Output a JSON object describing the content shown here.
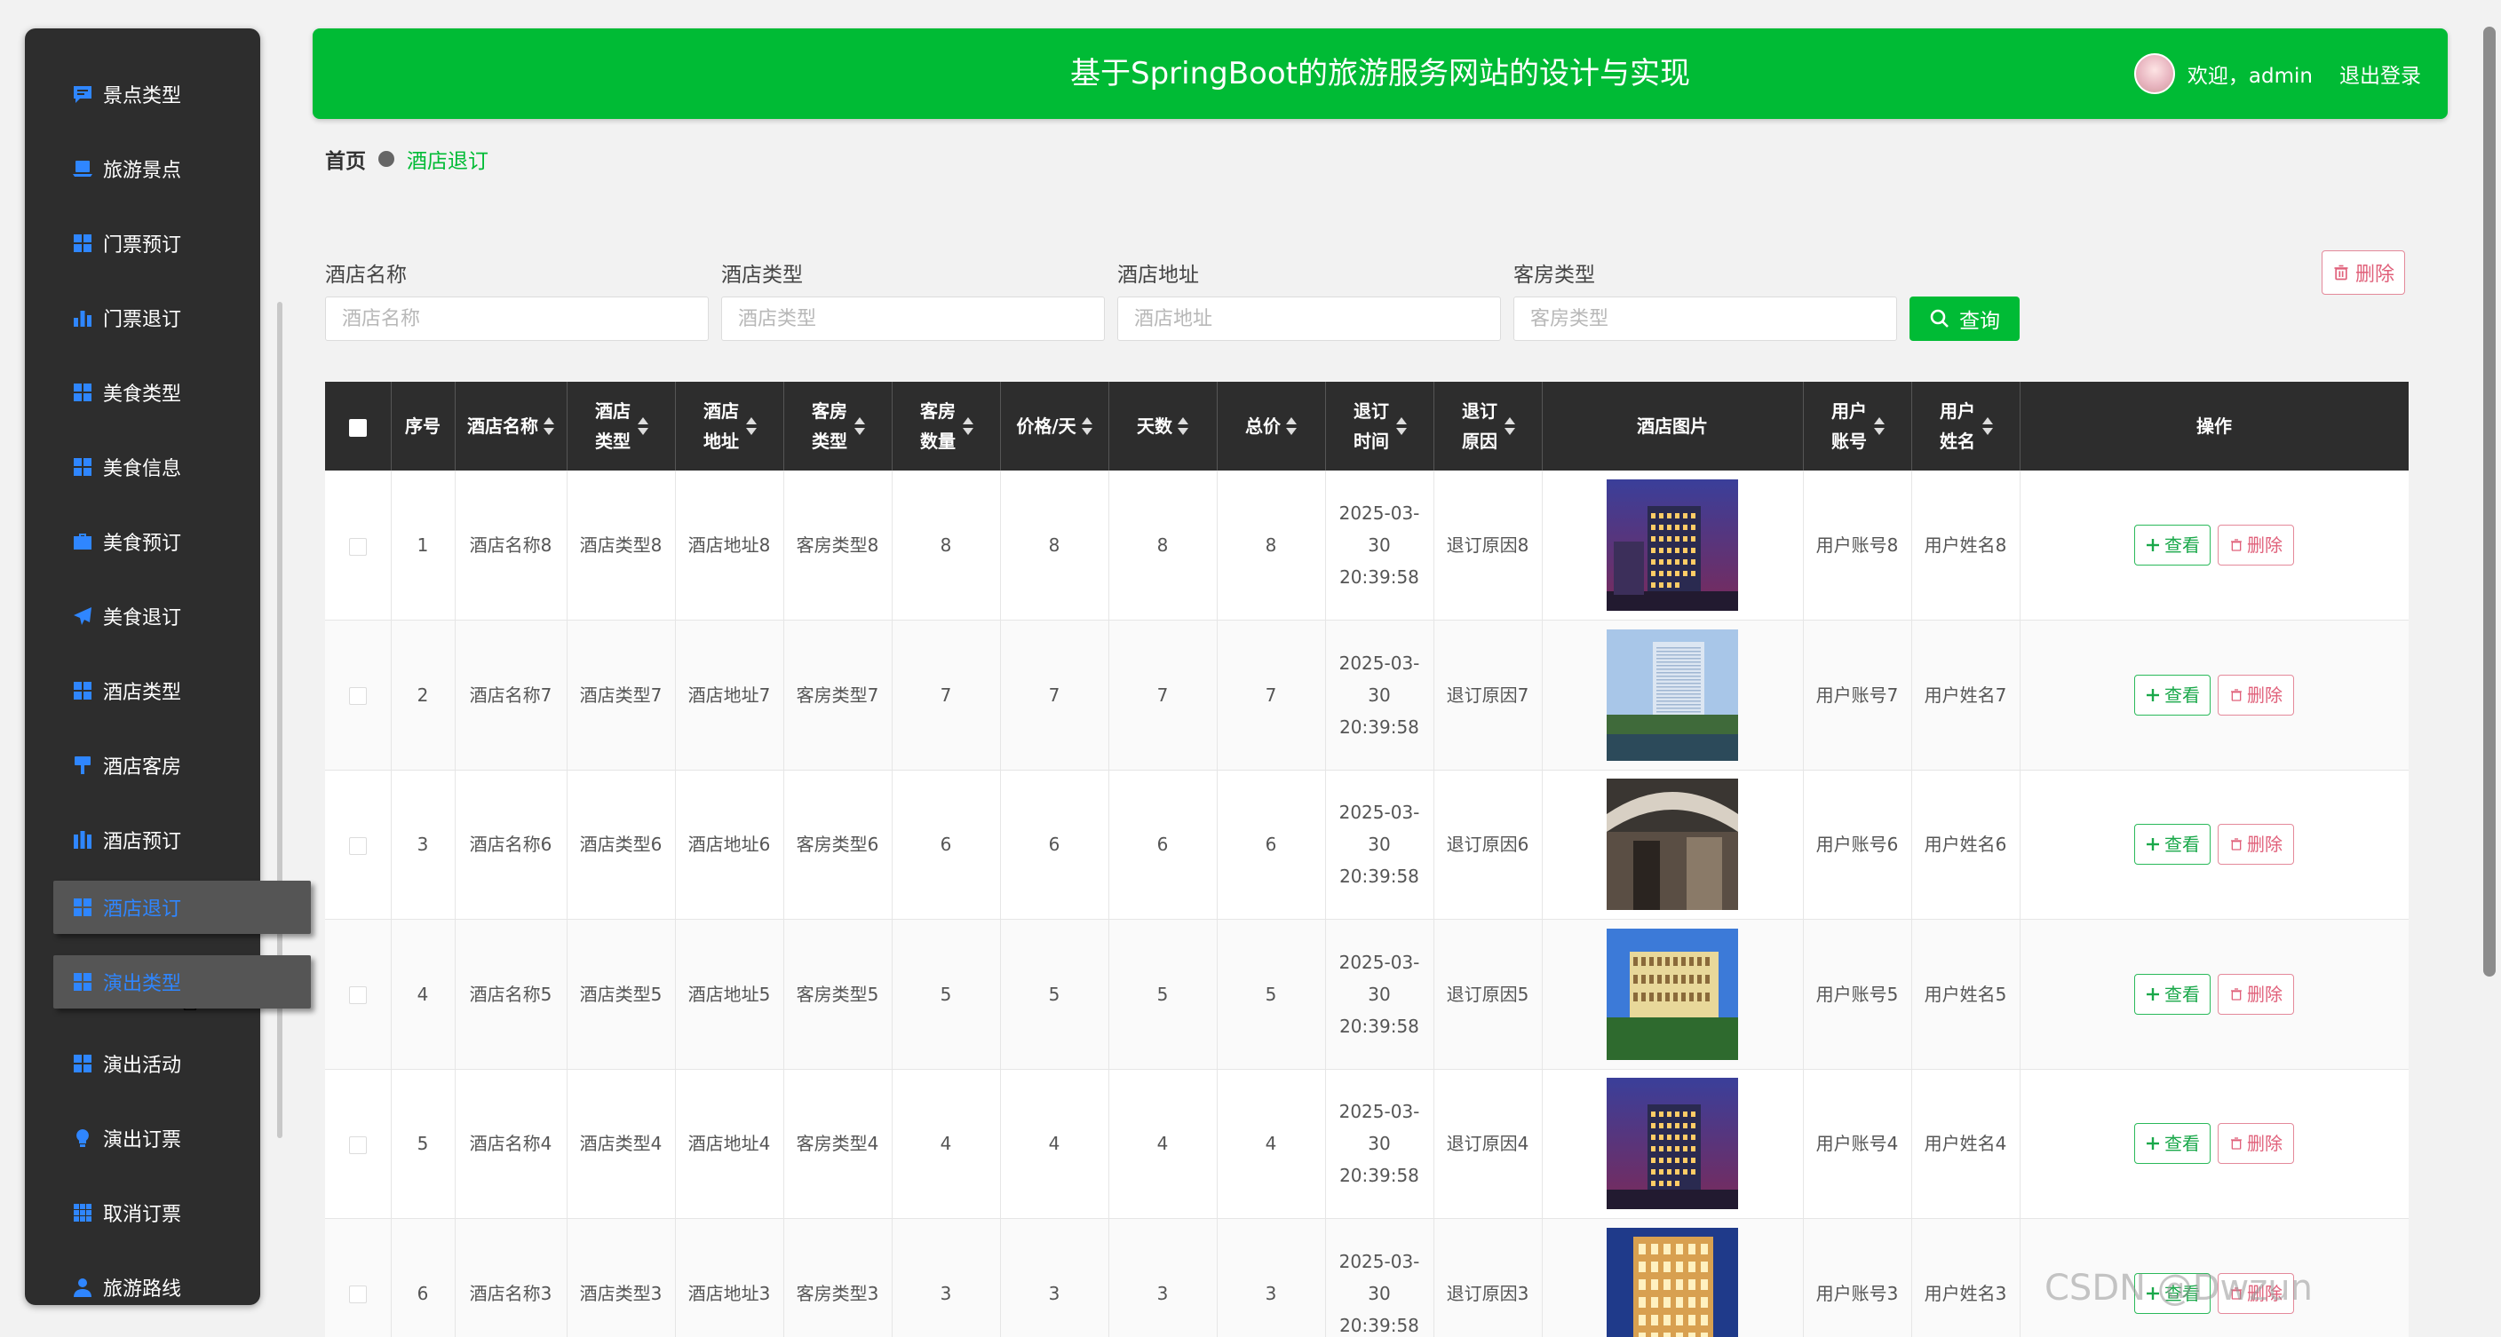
{
  "sidebar": {
    "items": [
      {
        "label": "景点类型",
        "icon": "chat-icon"
      },
      {
        "label": "旅游景点",
        "icon": "laptop-icon"
      },
      {
        "label": "门票预订",
        "icon": "grid-icon"
      },
      {
        "label": "门票退订",
        "icon": "bar-chart-icon"
      },
      {
        "label": "美食类型",
        "icon": "grid-icon"
      },
      {
        "label": "美食信息",
        "icon": "grid-icon"
      },
      {
        "label": "美食预订",
        "icon": "briefcase-icon"
      },
      {
        "label": "美食退订",
        "icon": "send-icon"
      },
      {
        "label": "酒店类型",
        "icon": "grid-icon"
      },
      {
        "label": "酒店客房",
        "icon": "brush-icon"
      },
      {
        "label": "酒店预订",
        "icon": "columns-icon"
      },
      {
        "label": "酒店退订",
        "icon": "grid-icon"
      },
      {
        "label": "演出类型",
        "icon": "grid-icon"
      },
      {
        "label": "演出活动",
        "icon": "grid-icon"
      },
      {
        "label": "演出订票",
        "icon": "bulb-icon"
      },
      {
        "label": "取消订票",
        "icon": "apps-icon"
      },
      {
        "label": "旅游路线",
        "icon": "user-icon"
      }
    ]
  },
  "header": {
    "title": "基于SpringBoot的旅游服务网站的设计与实现",
    "welcome": "欢迎，admin",
    "logout": "退出登录"
  },
  "breadcrumb": {
    "home": "首页",
    "current": "酒店退订"
  },
  "search": {
    "fields": [
      {
        "label": "酒店名称",
        "placeholder": "酒店名称"
      },
      {
        "label": "酒店类型",
        "placeholder": "酒店类型"
      },
      {
        "label": "酒店地址",
        "placeholder": "酒店地址"
      },
      {
        "label": "客房类型",
        "placeholder": "客房类型"
      }
    ],
    "query_label": "查询",
    "delete_label": "删除"
  },
  "table": {
    "columns": [
      "序号",
      "酒店名称",
      "酒店类型",
      "酒店地址",
      "客房类型",
      "客房数量",
      "价格/天",
      "天数",
      "总价",
      "退订时间",
      "退订原因",
      "酒店图片",
      "用户账号",
      "用户姓名",
      "操作"
    ],
    "view_label": "查看",
    "delete_label": "删除",
    "rows": [
      {
        "index": "1",
        "name": "酒店名称8",
        "type": "酒店类型8",
        "address": "酒店地址8",
        "room_type": "客房类型8",
        "rooms": "8",
        "price": "8",
        "days": "8",
        "total": "8",
        "time": "2025-03-30 20:39:58",
        "reason": "退订原因8",
        "account": "用户账号8",
        "username": "用户姓名8"
      },
      {
        "index": "2",
        "name": "酒店名称7",
        "type": "酒店类型7",
        "address": "酒店地址7",
        "room_type": "客房类型7",
        "rooms": "7",
        "price": "7",
        "days": "7",
        "total": "7",
        "time": "2025-03-30 20:39:58",
        "reason": "退订原因7",
        "account": "用户账号7",
        "username": "用户姓名7"
      },
      {
        "index": "3",
        "name": "酒店名称6",
        "type": "酒店类型6",
        "address": "酒店地址6",
        "room_type": "客房类型6",
        "rooms": "6",
        "price": "6",
        "days": "6",
        "total": "6",
        "time": "2025-03-30 20:39:58",
        "reason": "退订原因6",
        "account": "用户账号6",
        "username": "用户姓名6"
      },
      {
        "index": "4",
        "name": "酒店名称5",
        "type": "酒店类型5",
        "address": "酒店地址5",
        "room_type": "客房类型5",
        "rooms": "5",
        "price": "5",
        "days": "5",
        "total": "5",
        "time": "2025-03-30 20:39:58",
        "reason": "退订原因5",
        "account": "用户账号5",
        "username": "用户姓名5"
      },
      {
        "index": "5",
        "name": "酒店名称4",
        "type": "酒店类型4",
        "address": "酒店地址4",
        "room_type": "客房类型4",
        "rooms": "4",
        "price": "4",
        "days": "4",
        "total": "4",
        "time": "2025-03-30 20:39:58",
        "reason": "退订原因4",
        "account": "用户账号4",
        "username": "用户姓名4"
      },
      {
        "index": "6",
        "name": "酒店名称3",
        "type": "酒店类型3",
        "address": "酒店地址3",
        "room_type": "客房类型3",
        "rooms": "3",
        "price": "3",
        "days": "3",
        "total": "3",
        "time": "2025-03-30 20:39:58",
        "reason": "退订原因3",
        "account": "用户账号3",
        "username": "用户姓名3"
      }
    ]
  },
  "watermark": "CSDN @Dwzun",
  "colors": {
    "primary": "#00bb35",
    "sidebar": "#2d2d2d",
    "accent_blue": "#2f86ff",
    "danger": "#e0607a"
  }
}
